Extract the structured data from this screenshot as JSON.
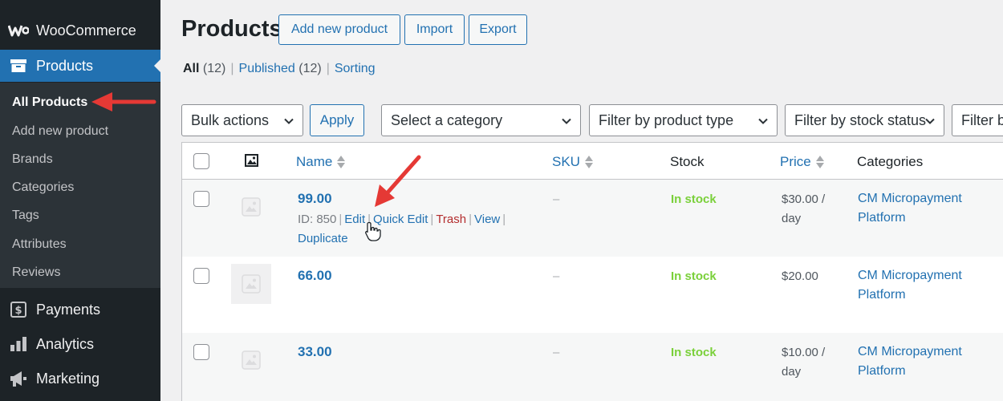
{
  "sidebar": {
    "brand_label": "WooCommerce",
    "products_label": "Products",
    "submenu": [
      "All Products",
      "Add new product",
      "Brands",
      "Categories",
      "Tags",
      "Attributes",
      "Reviews"
    ],
    "payments_label": "Payments",
    "analytics_label": "Analytics",
    "marketing_label": "Marketing"
  },
  "header": {
    "title": "Products",
    "add_new_label": "Add new product",
    "import_label": "Import",
    "export_label": "Export"
  },
  "views": {
    "all_label": "All",
    "all_count": "(12)",
    "published_label": "Published",
    "published_count": "(12)",
    "sorting_label": "Sorting"
  },
  "filters": {
    "bulk_actions": "Bulk actions",
    "apply_label": "Apply",
    "category": "Select a category",
    "product_type": "Filter by product type",
    "stock_status": "Filter by stock status",
    "brand_partial": "Filter b"
  },
  "table": {
    "columns": {
      "name": "Name",
      "sku": "SKU",
      "stock": "Stock",
      "price": "Price",
      "categories": "Categories"
    },
    "rows": [
      {
        "name": "99.00",
        "id_text": "ID: 850",
        "actions": [
          "Edit",
          "Quick Edit",
          "Trash",
          "View",
          "Duplicate"
        ],
        "sku": "–",
        "stock": "In stock",
        "price": "$30.00 / day",
        "category": "CM Micropayment Platform"
      },
      {
        "name": "66.00",
        "sku": "–",
        "stock": "In stock",
        "price": "$20.00",
        "category": "CM Micropayment Platform"
      },
      {
        "name": "33.00",
        "sku": "–",
        "stock": "In stock",
        "price": "$10.00 / day",
        "category": "CM Micropayment Platform"
      }
    ]
  },
  "colors": {
    "sidebar_bg": "#1d2327",
    "accent": "#2271b1",
    "in_stock": "#7ad03a",
    "trash": "#b32d2e",
    "annotation_arrow": "#e53935"
  }
}
